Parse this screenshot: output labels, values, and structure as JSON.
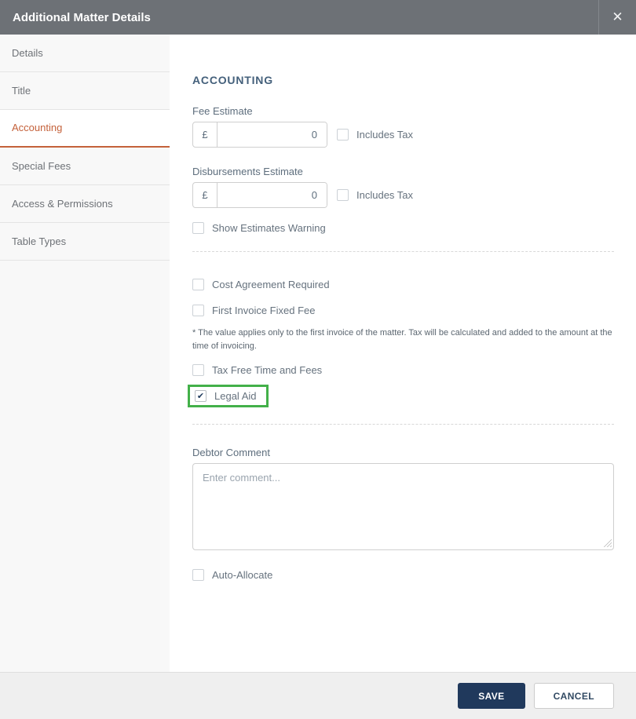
{
  "modal": {
    "title": "Additional Matter Details",
    "close_icon": "✕"
  },
  "sidebar": {
    "items": [
      {
        "label": "Details",
        "active": false
      },
      {
        "label": "Title",
        "active": false
      },
      {
        "label": "Accounting",
        "active": true
      },
      {
        "label": "Special Fees",
        "active": false
      },
      {
        "label": "Access & Permissions",
        "active": false
      },
      {
        "label": "Table Types",
        "active": false
      }
    ]
  },
  "content": {
    "section_title": "ACCOUNTING",
    "fee_estimate": {
      "label": "Fee Estimate",
      "currency": "£",
      "value": "0",
      "includes_tax_label": "Includes Tax",
      "includes_tax_checked": false
    },
    "disbursements_estimate": {
      "label": "Disbursements Estimate",
      "currency": "£",
      "value": "0",
      "includes_tax_label": "Includes Tax",
      "includes_tax_checked": false
    },
    "show_estimates_warning": {
      "label": "Show Estimates Warning",
      "checked": false
    },
    "cost_agreement_required": {
      "label": "Cost Agreement Required",
      "checked": false
    },
    "first_invoice_fixed_fee": {
      "label": "First Invoice Fixed Fee",
      "checked": false
    },
    "note": "* The value applies only to the first invoice of the matter. Tax will be calculated and added to the amount at the time of invoicing.",
    "tax_free_time_and_fees": {
      "label": "Tax Free Time and Fees",
      "checked": false
    },
    "legal_aid": {
      "label": "Legal Aid",
      "checked": true,
      "checkmark": "✔",
      "highlight_color": "#43b049"
    },
    "debtor_comment": {
      "label": "Debtor Comment",
      "placeholder": "Enter comment..."
    },
    "auto_allocate": {
      "label": "Auto-Allocate",
      "checked": false
    }
  },
  "footer": {
    "save_label": "SAVE",
    "cancel_label": "CANCEL"
  },
  "colors": {
    "header_bg": "#6d7176",
    "accent_orange": "#c4613a",
    "save_bg": "#20395c",
    "highlight_green": "#43b049"
  }
}
